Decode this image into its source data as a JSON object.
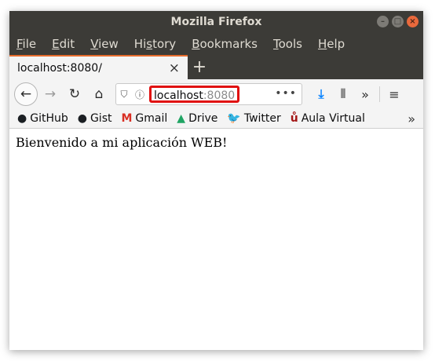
{
  "window": {
    "title": "Mozilla Firefox",
    "controls": {
      "minimize": "–",
      "maximize": "□",
      "close": "×"
    }
  },
  "menubar": {
    "items": [
      {
        "first": "F",
        "rest": "ile"
      },
      {
        "first": "E",
        "rest": "dit"
      },
      {
        "first": "V",
        "rest": "iew"
      },
      {
        "first": "",
        "pre": "Hi",
        "u": "s",
        "post": "tory",
        "label": "History"
      },
      {
        "first": "B",
        "rest": "ookmarks"
      },
      {
        "first": "T",
        "rest": "ools"
      },
      {
        "first": "H",
        "rest": "elp"
      }
    ]
  },
  "tabs": [
    {
      "label": "localhost:8080/",
      "close": "×"
    }
  ],
  "newtab_symbol": "+",
  "nav": {
    "back_symbol": "←",
    "forward_symbol": "→",
    "reload_symbol": "↻",
    "home_symbol": "⌂",
    "url_host": "localhost",
    "url_port": ":8080",
    "shield_symbol": "⛉",
    "info_symbol": "ⓘ",
    "more_symbol": "•••"
  },
  "toolbar_right": {
    "download_symbol": "⤓",
    "library_symbol": "⫴",
    "overflow_symbol": "»",
    "menu_symbol": "≡"
  },
  "bookmarks": [
    {
      "icon": "●",
      "label": "GitHub",
      "color": "#1b1f23"
    },
    {
      "icon": "●",
      "label": "Gist",
      "color": "#1b1f23"
    },
    {
      "icon": "M",
      "label": "Gmail",
      "color": "#d93025"
    },
    {
      "icon": "▲",
      "label": "Drive",
      "color": "#1fa463"
    },
    {
      "icon": "🐦",
      "label": "Twitter",
      "color": "#1da1f2"
    },
    {
      "icon": "ů",
      "label": "Aula Virtual",
      "color": "#a31515"
    }
  ],
  "bookmarks_more": "»",
  "page": {
    "body_text": "Bienvenido a mi aplicación WEB!"
  }
}
